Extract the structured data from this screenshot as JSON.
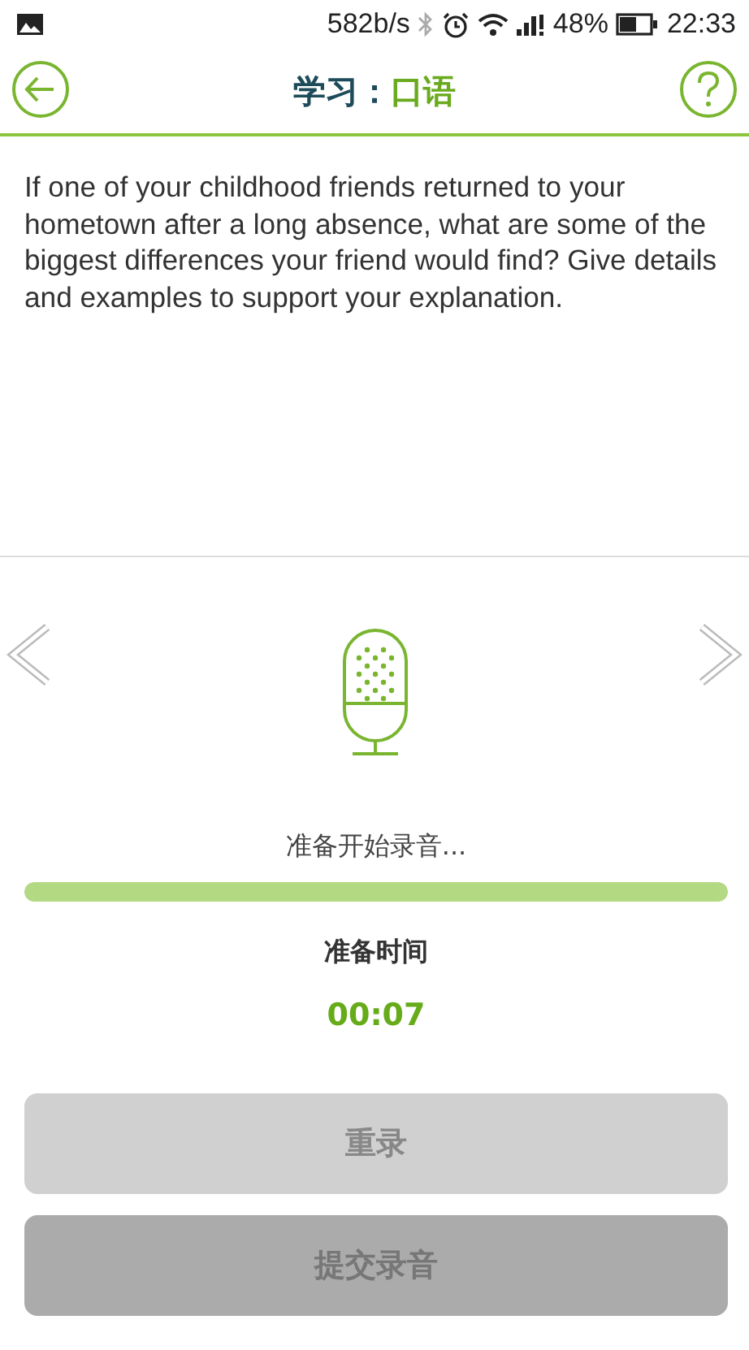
{
  "status_bar": {
    "speed": "582b/s",
    "battery": "48%",
    "time": "22:33"
  },
  "header": {
    "title_prefix": "学习：",
    "title_subject": "口语"
  },
  "question": "If one of your childhood friends returned to your hometown after a long absence, what are some of the biggest differences your friend would find? Give details and examples to support your explanation.",
  "recorder": {
    "status": "准备开始录音...",
    "level": 1,
    "timer_label": "准备时间",
    "timer": "00:07"
  },
  "buttons": [
    {
      "label": "重录",
      "kind": "retry",
      "disabled": true
    },
    {
      "label": "提交录音",
      "kind": "submit",
      "disabled": true
    }
  ]
}
